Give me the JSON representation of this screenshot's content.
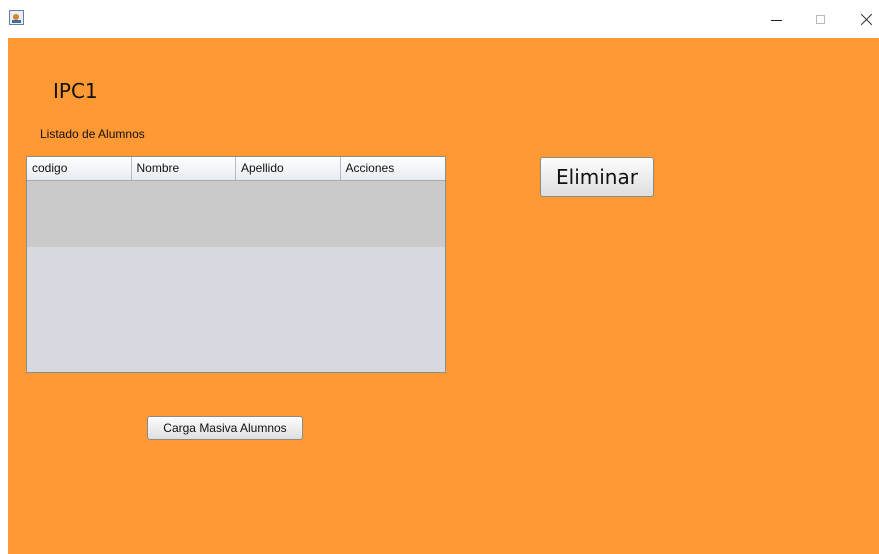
{
  "window": {
    "icon": "java-cup-icon",
    "controls": [
      "minimize-icon",
      "maximize-icon",
      "close-icon"
    ]
  },
  "app": {
    "title": "IPC1",
    "list_label": "Listado de Alumnos",
    "background_color": "#ff9933"
  },
  "table": {
    "columns": [
      "codigo",
      "Nombre",
      "Apellido",
      "Acciones"
    ],
    "rows": [
      {
        "codigo": "",
        "Nombre": "",
        "Apellido": "",
        "Acciones": ""
      }
    ]
  },
  "buttons": {
    "eliminar": "Eliminar",
    "carga_masiva": "Carga Masiva Alumnos"
  }
}
